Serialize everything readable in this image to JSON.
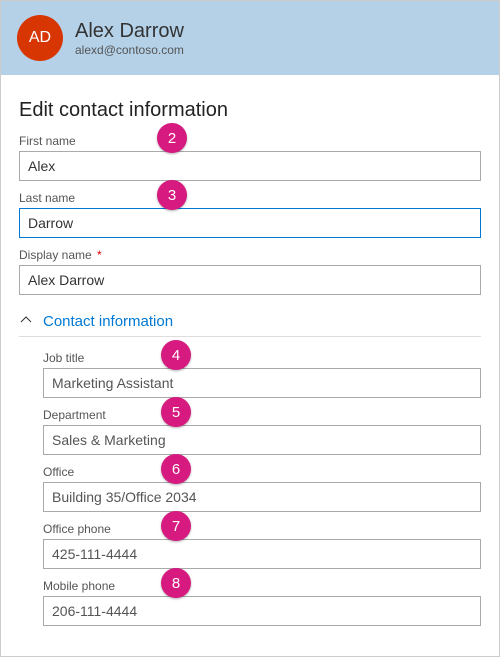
{
  "header": {
    "avatar_initials": "AD",
    "display_name": "Alex Darrow",
    "email": "alexd@contoso.com"
  },
  "page": {
    "heading": "Edit contact information"
  },
  "fields": {
    "first_name": {
      "label": "First name",
      "value": "Alex"
    },
    "last_name": {
      "label": "Last name",
      "value": "Darrow"
    },
    "display_name": {
      "label": "Display name",
      "value": "Alex Darrow",
      "required_mark": "*"
    }
  },
  "section": {
    "title": "Contact information"
  },
  "contact": {
    "job_title": {
      "label": "Job title",
      "value": "Marketing Assistant"
    },
    "department": {
      "label": "Department",
      "value": "Sales & Marketing"
    },
    "office": {
      "label": "Office",
      "value": "Building 35/Office 2034"
    },
    "office_phone": {
      "label": "Office phone",
      "value": "425-111-4444"
    },
    "mobile_phone": {
      "label": "Mobile phone",
      "value": "206-111-4444"
    }
  },
  "callouts": {
    "c2": "2",
    "c3": "3",
    "c4": "4",
    "c5": "5",
    "c6": "6",
    "c7": "7",
    "c8": "8"
  }
}
